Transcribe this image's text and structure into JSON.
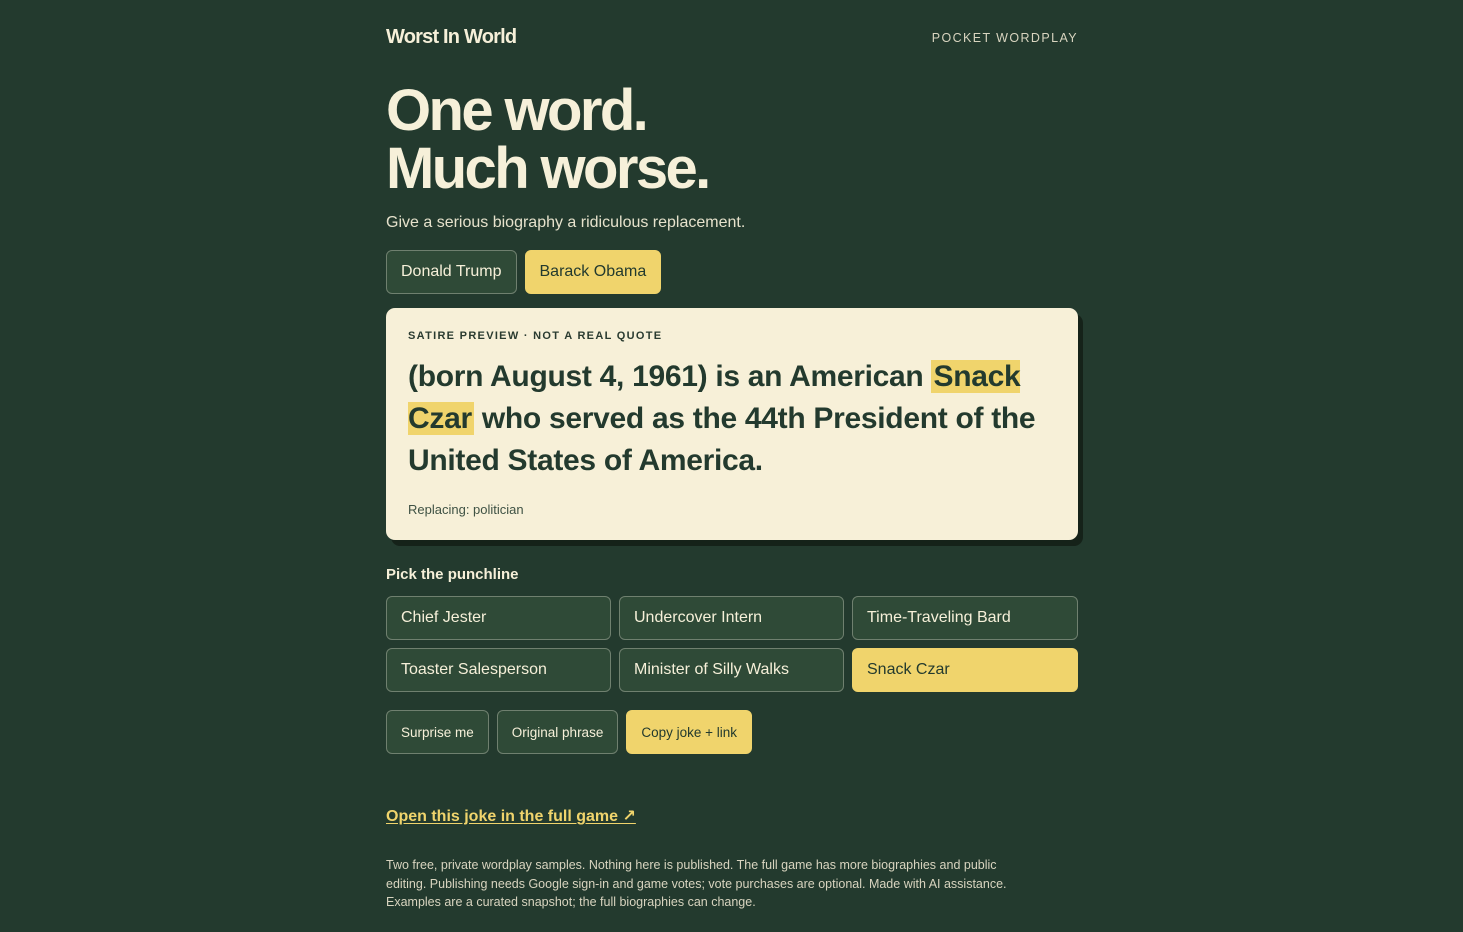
{
  "header": {
    "brand": "Worst In World",
    "tagline": "POCKET WORDPLAY"
  },
  "hero": {
    "line1": "One word.",
    "line2": "Much worse.",
    "subtitle": "Give a serious biography a ridiculous replacement."
  },
  "people": [
    {
      "label": "Donald Trump",
      "active": false
    },
    {
      "label": "Barack Obama",
      "active": true
    }
  ],
  "card": {
    "label": "SATIRE PREVIEW · NOT A REAL QUOTE",
    "before": "(born August 4, 1961) is an American ",
    "replacement": "Snack Czar",
    "after": " who served as the 44th President of the United States of America.",
    "replacing": "Replacing: politician"
  },
  "punchline": {
    "title": "Pick the punchline",
    "options": [
      {
        "label": "Chief Jester",
        "active": false
      },
      {
        "label": "Undercover Intern",
        "active": false
      },
      {
        "label": "Time-Traveling Bard",
        "active": false
      },
      {
        "label": "Toaster Salesperson",
        "active": false
      },
      {
        "label": "Minister of Silly Walks",
        "active": false
      },
      {
        "label": "Snack Czar",
        "active": true
      }
    ]
  },
  "actions": {
    "surprise": "Surprise me",
    "original": "Original phrase",
    "copy": "Copy joke + link"
  },
  "link": {
    "label": "Open this joke in the full game ↗"
  },
  "footer": {
    "text": "Two free, private wordplay samples. Nothing here is published. The full game has more biographies and public editing. Publishing needs Google sign-in and game votes; vote purchases are optional. Made with AI assistance. Examples are a curated snapshot; the full biographies can change."
  },
  "colors": {
    "background": "#233a2e",
    "accent": "#f0d46c",
    "card": "#f7f0d8",
    "text": "#f6f0d9"
  }
}
